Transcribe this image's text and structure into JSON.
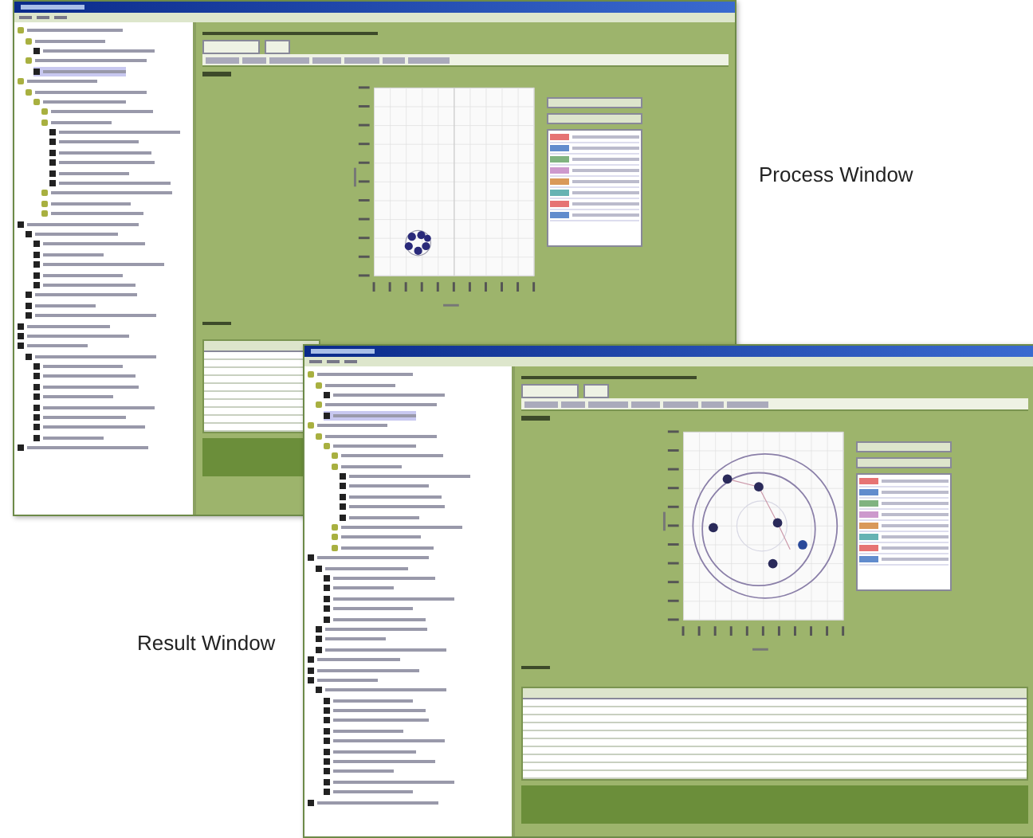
{
  "captions": [
    {
      "text": "Process Window"
    },
    {
      "text": "Result Window"
    }
  ],
  "windows": [
    {
      "chart": {
        "kind": "cluster"
      },
      "tree": [
        {
          "kind": "folder",
          "selected": false,
          "children": [
            {
              "kind": "folder",
              "selected": false,
              "children": [
                {
                  "kind": "item",
                  "selected": false
                }
              ]
            },
            {
              "kind": "folder",
              "selected": false,
              "children": [
                {
                  "kind": "item",
                  "selected": true
                }
              ]
            }
          ]
        },
        {
          "kind": "folder",
          "selected": false,
          "children": [
            {
              "kind": "folder",
              "selected": false,
              "children": [
                {
                  "kind": "folder",
                  "selected": false,
                  "children": [
                    {
                      "kind": "folder",
                      "selected": false
                    },
                    {
                      "kind": "folder",
                      "selected": false,
                      "children": [
                        {
                          "kind": "item",
                          "selected": false
                        },
                        {
                          "kind": "item",
                          "selected": false
                        },
                        {
                          "kind": "item",
                          "selected": false
                        },
                        {
                          "kind": "item",
                          "selected": false
                        },
                        {
                          "kind": "item",
                          "selected": false
                        },
                        {
                          "kind": "item",
                          "selected": false
                        }
                      ]
                    },
                    {
                      "kind": "folder",
                      "selected": false
                    },
                    {
                      "kind": "folder",
                      "selected": false
                    },
                    {
                      "kind": "folder",
                      "selected": false
                    }
                  ]
                }
              ]
            }
          ]
        },
        {
          "kind": "item",
          "selected": false,
          "children": [
            {
              "kind": "item",
              "selected": false,
              "children": [
                {
                  "kind": "item",
                  "selected": false
                },
                {
                  "kind": "item",
                  "selected": false
                },
                {
                  "kind": "item",
                  "selected": false
                },
                {
                  "kind": "item",
                  "selected": false
                },
                {
                  "kind": "item",
                  "selected": false
                }
              ]
            },
            {
              "kind": "item",
              "selected": false
            },
            {
              "kind": "item",
              "selected": false
            },
            {
              "kind": "item",
              "selected": false
            }
          ]
        },
        {
          "kind": "item",
          "selected": false
        },
        {
          "kind": "item",
          "selected": false
        },
        {
          "kind": "item",
          "selected": false,
          "children": [
            {
              "kind": "item",
              "selected": false,
              "children": [
                {
                  "kind": "item",
                  "selected": false
                },
                {
                  "kind": "item",
                  "selected": false
                },
                {
                  "kind": "item",
                  "selected": false
                },
                {
                  "kind": "item",
                  "selected": false
                },
                {
                  "kind": "item",
                  "selected": false
                },
                {
                  "kind": "item",
                  "selected": false
                },
                {
                  "kind": "item",
                  "selected": false
                },
                {
                  "kind": "item",
                  "selected": false
                }
              ]
            }
          ]
        },
        {
          "kind": "item",
          "selected": false
        }
      ]
    },
    {
      "chart": {
        "kind": "rings"
      },
      "tree": [
        {
          "kind": "folder",
          "selected": false,
          "children": [
            {
              "kind": "folder",
              "selected": false,
              "children": [
                {
                  "kind": "item",
                  "selected": false
                }
              ]
            },
            {
              "kind": "folder",
              "selected": false,
              "children": [
                {
                  "kind": "item",
                  "selected": true
                }
              ]
            }
          ]
        },
        {
          "kind": "folder",
          "selected": false,
          "children": [
            {
              "kind": "folder",
              "selected": false,
              "children": [
                {
                  "kind": "folder",
                  "selected": false,
                  "children": [
                    {
                      "kind": "folder",
                      "selected": false
                    },
                    {
                      "kind": "folder",
                      "selected": false,
                      "children": [
                        {
                          "kind": "item",
                          "selected": false
                        },
                        {
                          "kind": "item",
                          "selected": false
                        },
                        {
                          "kind": "item",
                          "selected": false
                        },
                        {
                          "kind": "item",
                          "selected": false
                        },
                        {
                          "kind": "item",
                          "selected": false
                        }
                      ]
                    },
                    {
                      "kind": "folder",
                      "selected": false
                    },
                    {
                      "kind": "folder",
                      "selected": false
                    },
                    {
                      "kind": "folder",
                      "selected": false
                    }
                  ]
                }
              ]
            }
          ]
        },
        {
          "kind": "item",
          "selected": false,
          "children": [
            {
              "kind": "item",
              "selected": false,
              "children": [
                {
                  "kind": "item",
                  "selected": false
                },
                {
                  "kind": "item",
                  "selected": false
                },
                {
                  "kind": "item",
                  "selected": false
                },
                {
                  "kind": "item",
                  "selected": false
                },
                {
                  "kind": "item",
                  "selected": false
                }
              ]
            },
            {
              "kind": "item",
              "selected": false
            },
            {
              "kind": "item",
              "selected": false
            },
            {
              "kind": "item",
              "selected": false
            }
          ]
        },
        {
          "kind": "item",
          "selected": false
        },
        {
          "kind": "item",
          "selected": false
        },
        {
          "kind": "item",
          "selected": false,
          "children": [
            {
              "kind": "item",
              "selected": false,
              "children": [
                {
                  "kind": "item",
                  "selected": false
                },
                {
                  "kind": "item",
                  "selected": false
                },
                {
                  "kind": "item",
                  "selected": false
                },
                {
                  "kind": "item",
                  "selected": false
                },
                {
                  "kind": "item",
                  "selected": false
                },
                {
                  "kind": "item",
                  "selected": false
                },
                {
                  "kind": "item",
                  "selected": false
                },
                {
                  "kind": "item",
                  "selected": false
                },
                {
                  "kind": "item",
                  "selected": false
                },
                {
                  "kind": "item",
                  "selected": false
                }
              ]
            }
          ]
        },
        {
          "kind": "item",
          "selected": false
        }
      ]
    }
  ]
}
